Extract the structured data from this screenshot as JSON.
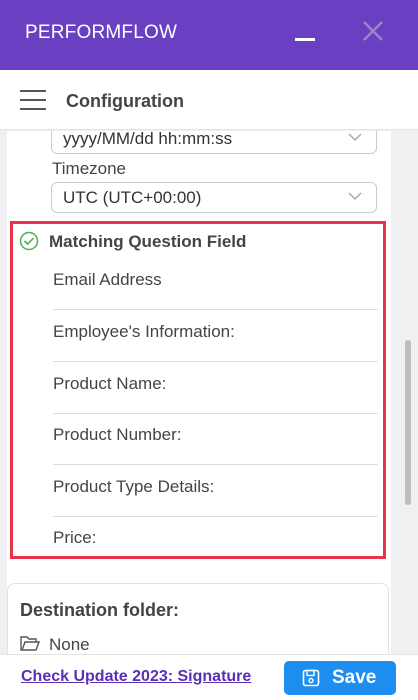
{
  "window": {
    "title": "PERFORMFLOW"
  },
  "header": {
    "title": "Configuration"
  },
  "settings": {
    "date_format_value": "yyyy/MM/dd hh:mm:ss",
    "timezone_label": "Timezone",
    "timezone_value": "UTC (UTC+00:00)"
  },
  "matching_question_field": {
    "title": "Matching Question Field",
    "fields": [
      "Email Address",
      "Employee's Information:",
      "Product Name:",
      "Product Number:",
      "Product Type Details:",
      "Price:"
    ]
  },
  "destination": {
    "title": "Destination folder:",
    "folder": "None"
  },
  "footer": {
    "link_label": "Check Update 2023: Signature",
    "save_label": "Save"
  },
  "colors": {
    "brand": "#6a3fc1",
    "highlight": "#e8334a",
    "save_button": "#1d8ef0",
    "check": "#4caf50",
    "link": "#5a2fb8"
  }
}
